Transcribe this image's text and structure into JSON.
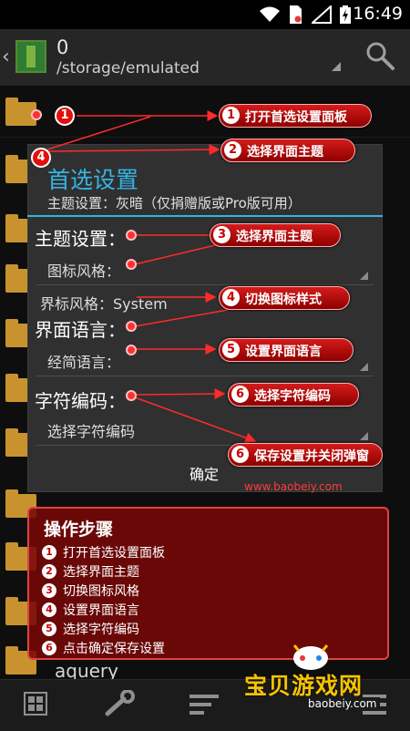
{
  "status_bar": {
    "time": "16:49"
  },
  "action_bar": {
    "title": "0",
    "path": "/storage/emulated"
  },
  "file_list": {
    "visible_item": "aquery"
  },
  "dialog": {
    "title": "首选设置",
    "subtitle": "主题设置：灰暗（仅捐赠版或Pro版可用）",
    "theme_label": "主题设置：",
    "icon_style_label": "图标风格：",
    "cursor_style_label": "界标风格：System",
    "ui_language_label": "界面语言：",
    "classic_language_label": "经简语言：",
    "charset_label": "字符编码：",
    "charset_value": "选择字符编码",
    "ok_button": "确定"
  },
  "watermark": "www.baobeiy.com",
  "annotations": [
    {
      "num": "1",
      "text": "打开首选设置面板"
    },
    {
      "num": "2",
      "text": "选择界面主题"
    },
    {
      "num": "3",
      "text": "选择界面主题"
    },
    {
      "num": "4",
      "text": "切换图标样式"
    },
    {
      "num": "5",
      "text": "设置界面语言"
    },
    {
      "num": "6",
      "text": "选择字符编码"
    },
    {
      "num": "6",
      "text": "保存设置并关闭弹窗"
    }
  ],
  "badges": {
    "b1": "1",
    "b4": "4"
  },
  "steps": {
    "title": "操作步骤",
    "items": [
      {
        "num": "1",
        "text": "打开首选设置面板"
      },
      {
        "num": "2",
        "text": "选择界面主题"
      },
      {
        "num": "3",
        "text": "切换图标风格"
      },
      {
        "num": "4",
        "text": "设置界面语言"
      },
      {
        "num": "5",
        "text": "选择字符编码"
      },
      {
        "num": "6",
        "text": "点击确定保存设置"
      }
    ]
  },
  "logo": {
    "name": "宝贝游戏网",
    "url": "baobeiy.com"
  },
  "colors": {
    "accent": "#33b5e5",
    "annotation_red": "#d41b1b",
    "folder": "#c8932e",
    "logo_yellow": "#f7c300"
  },
  "icons": [
    "wifi-icon",
    "sim-icon",
    "signal-icon",
    "battery-icon",
    "search-icon",
    "grid-icon",
    "wrench-icon",
    "sort-icon",
    "menu-icon",
    "folder-icon",
    "mascot-icon"
  ]
}
